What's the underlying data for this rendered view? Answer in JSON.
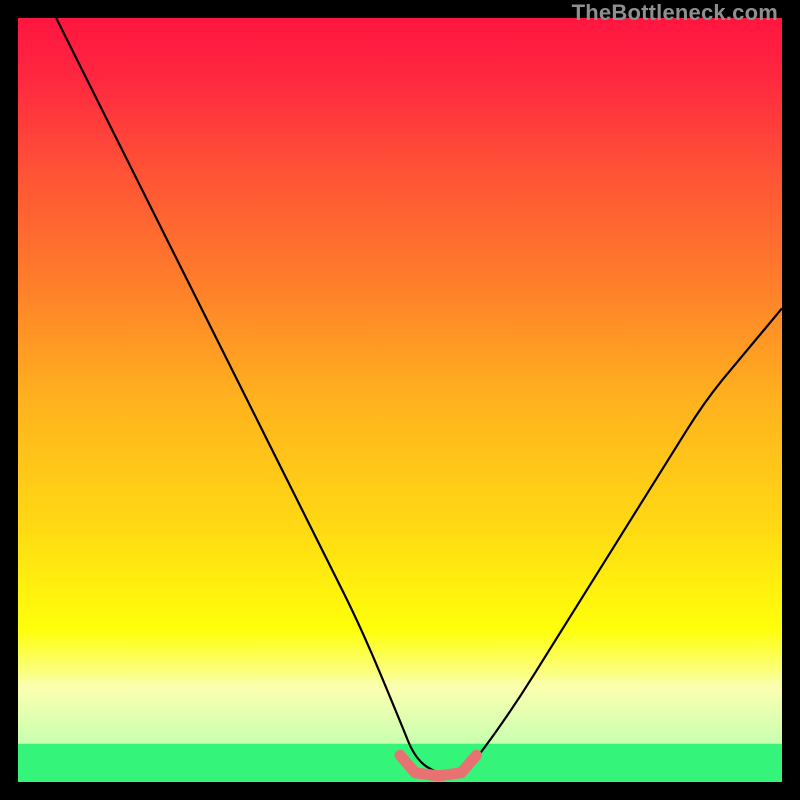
{
  "watermark": "TheBottleneck.com",
  "colors": {
    "highlight_stroke": "#e87272",
    "curve_stroke": "#000000",
    "green_band": "#34f47a",
    "yellow_band": "#f9ffb0"
  },
  "chart_data": {
    "type": "line",
    "title": "",
    "xlabel": "",
    "ylabel": "",
    "xlim": [
      0,
      100
    ],
    "ylim": [
      0,
      100
    ],
    "grid": false,
    "legend": false,
    "gradient_stops": [
      {
        "offset": 0.0,
        "color": "#ff153f"
      },
      {
        "offset": 0.08,
        "color": "#ff2840"
      },
      {
        "offset": 0.2,
        "color": "#ff5236"
      },
      {
        "offset": 0.35,
        "color": "#ff7f2a"
      },
      {
        "offset": 0.5,
        "color": "#ffb21e"
      },
      {
        "offset": 0.65,
        "color": "#ffd514"
      },
      {
        "offset": 0.8,
        "color": "#ffff0a"
      },
      {
        "offset": 0.88,
        "color": "#f9ffb0"
      },
      {
        "offset": 0.94,
        "color": "#9cffb0"
      },
      {
        "offset": 1.0,
        "color": "#34f47a"
      }
    ],
    "series": [
      {
        "name": "bottleneck-curve",
        "x": [
          5,
          10,
          15,
          20,
          25,
          30,
          35,
          40,
          45,
          50,
          52,
          55,
          58,
          60,
          65,
          70,
          75,
          80,
          85,
          90,
          95,
          100
        ],
        "y": [
          100,
          90,
          80,
          70,
          60,
          50,
          40,
          30,
          20,
          8,
          3,
          1,
          1,
          3,
          10,
          18,
          26,
          34,
          42,
          50,
          56,
          62
        ]
      }
    ],
    "highlight_segment": {
      "x": [
        50,
        52,
        55,
        58,
        60
      ],
      "y": [
        3.5,
        1.2,
        0.8,
        1.2,
        3.5
      ]
    }
  }
}
